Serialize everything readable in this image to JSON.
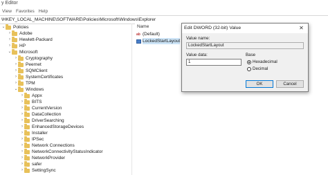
{
  "window": {
    "title": "y Editor"
  },
  "menu": [
    "View",
    "Favorites",
    "Help"
  ],
  "address": "\\HKEY_LOCAL_MACHINE\\SOFTWARE\\Policies\\Microsoft\\Windows\\Explorer",
  "tree": [
    {
      "label": "Policies",
      "level": 0,
      "open": true
    },
    {
      "label": "Adobe",
      "level": 1,
      "open": false
    },
    {
      "label": "Hewlett-Packard",
      "level": 1,
      "open": false
    },
    {
      "label": "HP",
      "level": 1,
      "open": false
    },
    {
      "label": "Microsoft",
      "level": 1,
      "open": true
    },
    {
      "label": "Cryptography",
      "level": 2,
      "open": false
    },
    {
      "label": "Peernet",
      "level": 2,
      "open": false
    },
    {
      "label": "SQMClient",
      "level": 2,
      "open": false
    },
    {
      "label": "SystemCertificates",
      "level": 2,
      "open": false
    },
    {
      "label": "TPM",
      "level": 2,
      "open": false
    },
    {
      "label": "Windows",
      "level": 2,
      "open": true
    },
    {
      "label": "Appx",
      "level": 3,
      "open": false
    },
    {
      "label": "BITS",
      "level": 3,
      "open": false
    },
    {
      "label": "CurrentVersion",
      "level": 3,
      "open": false
    },
    {
      "label": "DataCollection",
      "level": 3,
      "open": false
    },
    {
      "label": "DriverSearching",
      "level": 3,
      "open": false
    },
    {
      "label": "EnhancedStorageDevices",
      "level": 3,
      "open": false
    },
    {
      "label": "Installer",
      "level": 3,
      "open": false
    },
    {
      "label": "IPSec",
      "level": 3,
      "open": false
    },
    {
      "label": "Network Connections",
      "level": 3,
      "open": false
    },
    {
      "label": "NetworkConnectivityStatusIndicator",
      "level": 3,
      "open": false
    },
    {
      "label": "NetworkProvider",
      "level": 3,
      "open": false
    },
    {
      "label": "safer",
      "level": 3,
      "open": false
    },
    {
      "label": "SettingSync",
      "level": 3,
      "open": false
    }
  ],
  "values_pane": {
    "column_name": "Name",
    "rows": [
      {
        "name": "(Default)",
        "type": "string"
      },
      {
        "name": "LockedStartLayout",
        "type": "dword",
        "suffix": "F"
      }
    ]
  },
  "dialog": {
    "title": "Edit DWORD (32-bit) Value",
    "value_name_label": "Value name:",
    "value_name": "LockedStartLayout",
    "value_data_label": "Value data:",
    "value_data": "1",
    "base_label": "Base",
    "base_options": [
      {
        "label": "Hexadecimal",
        "selected": true
      },
      {
        "label": "Decimal",
        "selected": false
      }
    ],
    "ok_label": "OK",
    "cancel_label": "Cancel"
  }
}
